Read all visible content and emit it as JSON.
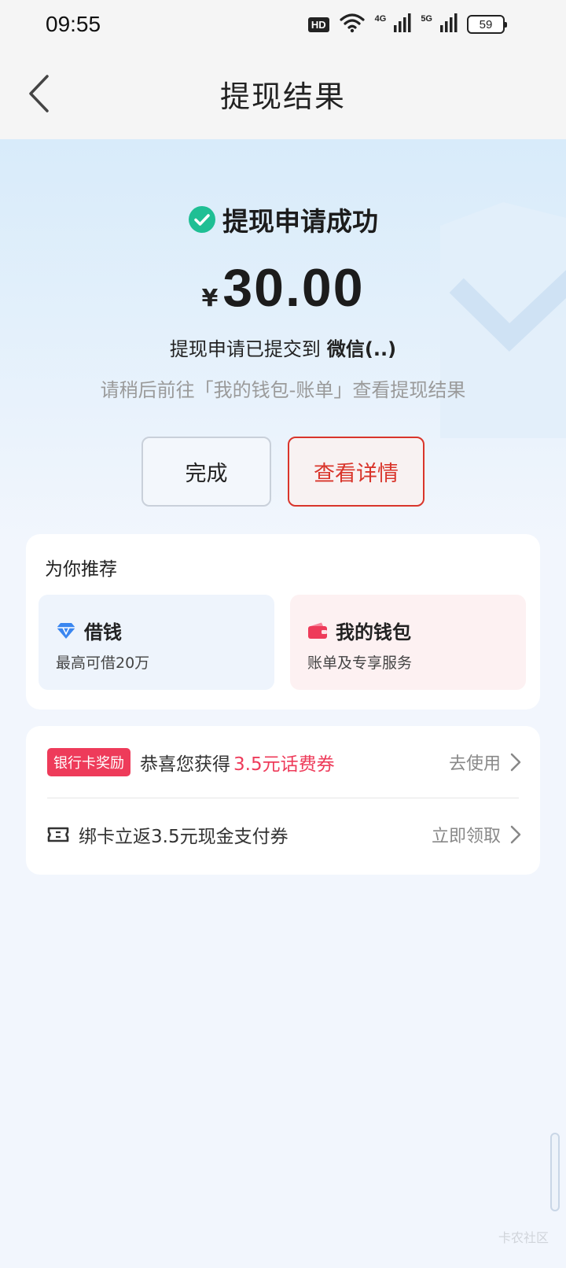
{
  "status_bar": {
    "time": "09:55",
    "hd_label": "HD",
    "network_1": "4G",
    "network_2": "5G",
    "battery": "59"
  },
  "nav": {
    "title": "提现结果",
    "back_icon": "chevron-left-icon"
  },
  "result": {
    "status_text": "提现申请成功",
    "status_icon": "check-circle-icon",
    "status_color": "#1fbf94",
    "currency_symbol": "¥",
    "amount": "30.00",
    "submitted_prefix": "提现申请已提交到",
    "submitted_destination": "微信(..)",
    "hint": "请稍后前往「我的钱包-账单」查看提现结果"
  },
  "actions": {
    "done_label": "完成",
    "detail_label": "查看详情",
    "accent_color": "#d9352b"
  },
  "recommend": {
    "title": "为你推荐",
    "items": [
      {
        "icon": "diamond-icon",
        "title": "借钱",
        "subtitle": "最高可借20万"
      },
      {
        "icon": "wallet-icon",
        "title": "我的钱包",
        "subtitle": "账单及专享服务"
      }
    ]
  },
  "rewards": {
    "rows": [
      {
        "badge": "银行卡奖励",
        "text": "恭喜您获得",
        "highlight": "3.5元话费券",
        "action": "去使用"
      },
      {
        "icon": "ticket-icon",
        "text": "绑卡立返3.5元现金支付券",
        "action": "立即领取"
      }
    ],
    "highlight_color": "#ee3b5a"
  },
  "watermark": "卡农社区"
}
